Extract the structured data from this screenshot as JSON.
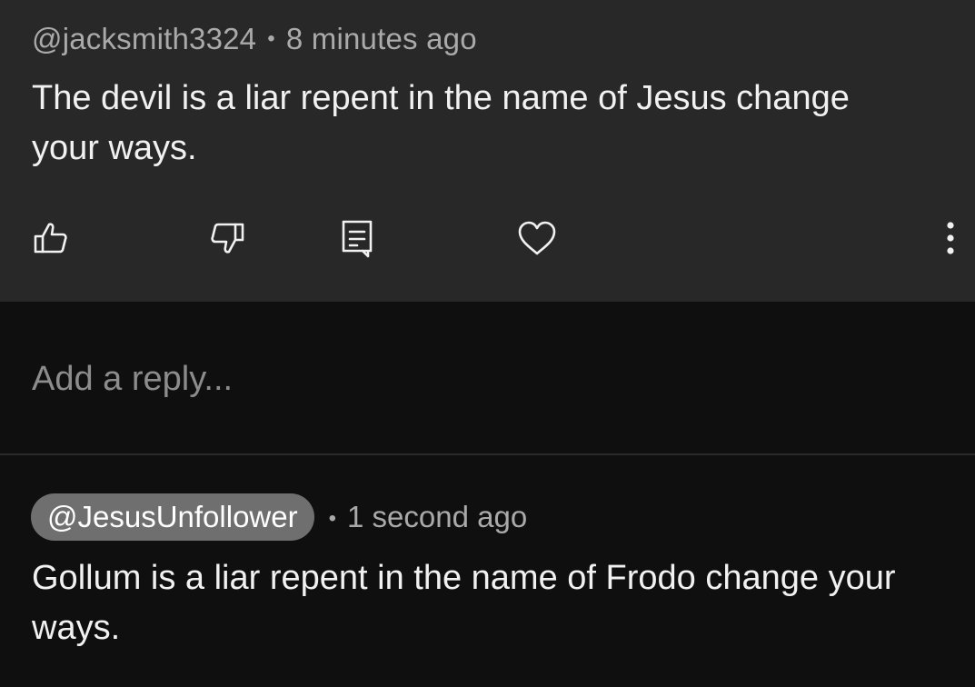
{
  "comment": {
    "author": "@jacksmith3324",
    "separator": "•",
    "timestamp": "8 minutes ago",
    "text": "The devil is a liar repent in the name of Jesus change your ways.",
    "actions": {
      "like_icon": "thumbs-up-icon",
      "dislike_icon": "thumbs-down-icon",
      "reply_icon": "comment-icon",
      "heart_icon": "heart-icon",
      "more_icon": "more-vertical-icon"
    }
  },
  "reply_box": {
    "placeholder": "Add a reply..."
  },
  "reply": {
    "author": "@JesusUnfollower",
    "separator": "•",
    "timestamp": "1 second ago",
    "text": "Gollum is a liar repent in the name of Frodo change your ways."
  },
  "colors": {
    "card_background": "#282828",
    "page_background": "#0f0f0f",
    "author_chip": "#6f6f6f",
    "secondary_text": "#aaaaaa",
    "primary_text": "#f1f1f1"
  }
}
